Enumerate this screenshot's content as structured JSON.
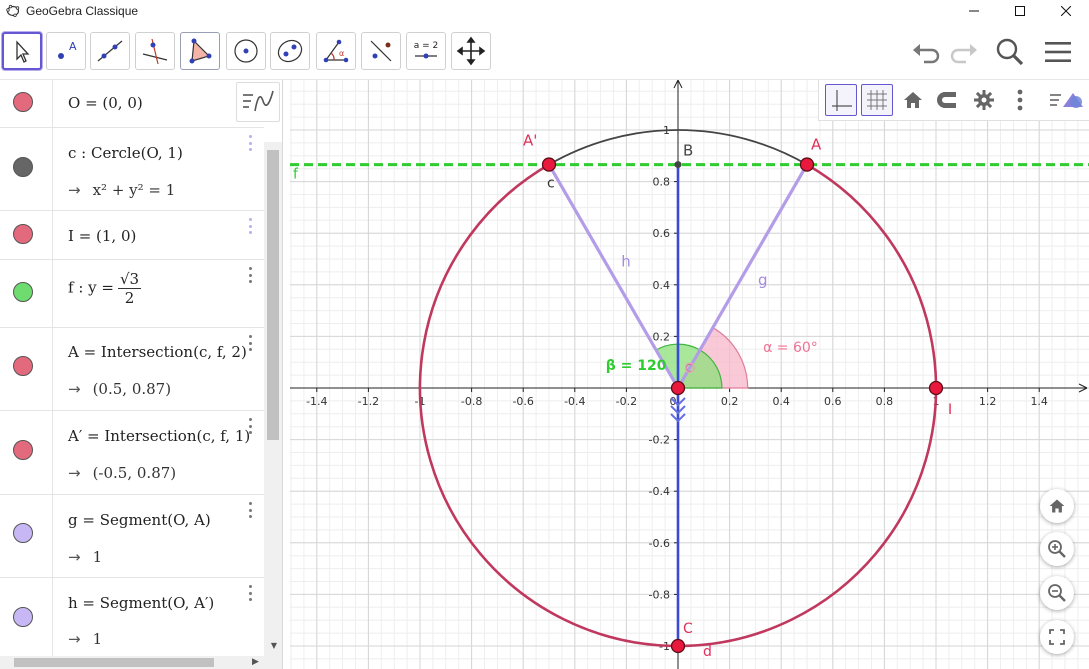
{
  "window": {
    "title": "GeoGebra Classique"
  },
  "toolbar": {
    "parameter_tool_label": "a = 2"
  },
  "algebra": {
    "rows": [
      {
        "def": "O = (0, 0)",
        "value": "",
        "color": "#e36a7d"
      },
      {
        "def": "c : Cercle(O, 1)",
        "value": "x² + y² = 1",
        "color": "#666666"
      },
      {
        "def": "I = (1, 0)",
        "value": "",
        "color": "#e36a7d"
      },
      {
        "def": "f : y =",
        "num": "√3",
        "den": "2",
        "value": "",
        "color": "#6fdc6f"
      },
      {
        "def": "A = Intersection(c, f, 2)",
        "value": "(0.5, 0.87)",
        "color": "#e36a7d"
      },
      {
        "def": "A′ = Intersection(c, f, 1)",
        "value": "(-0.5, 0.87)",
        "color": "#e36a7d"
      },
      {
        "def": "g = Segment(O, A)",
        "value": "1",
        "color": "#c7b8f5"
      },
      {
        "def": "h = Segment(O, A′)",
        "value": "1",
        "color": "#c7b8f5"
      }
    ],
    "arrow": "→"
  },
  "graphics": {
    "x_ticks": [
      "-1.4",
      "-1.2",
      "-1",
      "-0.8",
      "-0.6",
      "-0.4",
      "-0.2",
      "0",
      "0.2",
      "0.4",
      "0.6",
      "0.8",
      "1",
      "1.2",
      "1.4"
    ],
    "y_ticks_pos": [
      "0.2",
      "0.4",
      "0.6",
      "0.8",
      "1"
    ],
    "y_ticks_neg": [
      "-0.2",
      "-0.4",
      "-0.6",
      "-0.8",
      "-1"
    ],
    "labels": {
      "A": "A",
      "A_prime": "A'",
      "B": "B",
      "C": "C",
      "O": "O",
      "I": "I",
      "c": "c",
      "d": "d",
      "f": "f",
      "g": "g",
      "h": "h",
      "alpha": "α = 60°",
      "beta": "β = 120"
    },
    "colors": {
      "circle": "#c0385e",
      "circle_arc_top": "#444444",
      "line_f": "#2fcc2f",
      "segments": "#b39ce8",
      "axis_line": "#3a49d6",
      "point": "#e8193c",
      "alpha_fill": "#f7b7c9",
      "beta_fill": "#8ce07a"
    }
  }
}
